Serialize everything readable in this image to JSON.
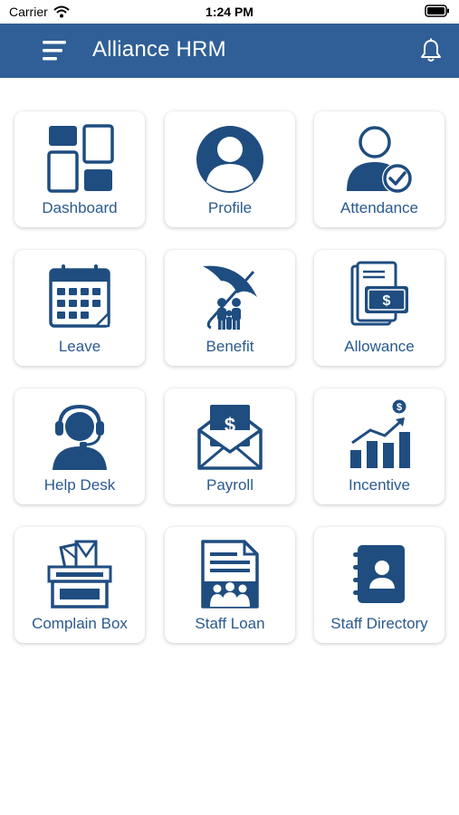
{
  "status_bar": {
    "carrier": "Carrier",
    "time": "1:24 PM"
  },
  "header": {
    "title": "Alliance HRM",
    "menu_icon": "hamburger-icon",
    "notification_icon": "bell-icon"
  },
  "colors": {
    "primary": "#2f5f96",
    "icon": "#1f4d80",
    "label": "#2a5a8f",
    "background": "#ffffff"
  },
  "tiles": [
    {
      "label": "Dashboard",
      "icon": "dashboard-grid-icon"
    },
    {
      "label": "Profile",
      "icon": "profile-user-icon"
    },
    {
      "label": "Attendance",
      "icon": "attendance-check-icon"
    },
    {
      "label": "Leave",
      "icon": "calendar-icon"
    },
    {
      "label": "Benefit",
      "icon": "umbrella-family-icon"
    },
    {
      "label": "Allowance",
      "icon": "document-money-icon"
    },
    {
      "label": "Help Desk",
      "icon": "headset-icon"
    },
    {
      "label": "Payroll",
      "icon": "envelope-dollar-icon"
    },
    {
      "label": "Incentive",
      "icon": "growth-chart-icon"
    },
    {
      "label": "Complain Box",
      "icon": "mail-box-icon"
    },
    {
      "label": "Staff Loan",
      "icon": "document-group-icon"
    },
    {
      "label": "Staff Directory",
      "icon": "contact-book-icon"
    }
  ]
}
